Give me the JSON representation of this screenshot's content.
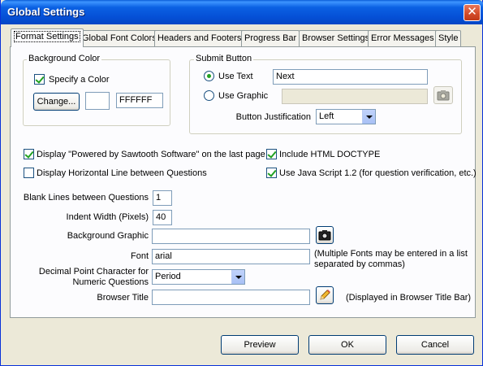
{
  "window": {
    "title": "Global Settings",
    "close_glyph": "✕"
  },
  "tabs": [
    {
      "label": "Format Settings",
      "active": true
    },
    {
      "label": "Global Font Colors"
    },
    {
      "label": "Headers and Footers"
    },
    {
      "label": "Progress Bar"
    },
    {
      "label": "Browser Settings"
    },
    {
      "label": "Error Messages"
    },
    {
      "label": "Style"
    }
  ],
  "background_color": {
    "legend": "Background Color",
    "specify_label": "Specify a Color",
    "specify_checked": true,
    "change_label": "Change...",
    "hex_value": "FFFFFF"
  },
  "submit_button": {
    "legend": "Submit Button",
    "use_text_label": "Use Text",
    "use_text_value": "Next",
    "use_graphic_label": "Use Graphic",
    "use_graphic_value": "",
    "justification_label": "Button Justification",
    "justification_value": "Left",
    "selected_mode": "text"
  },
  "options": {
    "powered_by_label": "Display \"Powered by Sawtooth Software\" on the last page",
    "powered_by_checked": true,
    "horizontal_line_label": "Display Horizontal Line between Questions",
    "horizontal_line_checked": false,
    "doctype_label": "Include HTML DOCTYPE",
    "doctype_checked": true,
    "javascript_label": "Use Java Script 1.2 (for question verification, etc.)",
    "javascript_checked": true
  },
  "fields": {
    "blank_lines_label": "Blank Lines between Questions",
    "blank_lines_value": "1",
    "indent_label": "Indent Width (Pixels)",
    "indent_value": "40",
    "bg_graphic_label": "Background Graphic",
    "bg_graphic_value": "",
    "font_label": "Font",
    "font_value": "arial",
    "font_note_line1": "(Multiple Fonts may be entered in a list",
    "font_note_line2": "separated by commas)",
    "decimal_label_line1": "Decimal Point Character for",
    "decimal_label_line2": "Numeric Questions",
    "decimal_value": "Period",
    "browser_title_label": "Browser Title",
    "browser_title_value": "",
    "browser_title_note": "(Displayed in Browser Title Bar)"
  },
  "footer": {
    "preview_label": "Preview",
    "ok_label": "OK",
    "cancel_label": "Cancel"
  },
  "icons": {
    "camera": "camera-icon",
    "pencil": "pencil-icon"
  }
}
